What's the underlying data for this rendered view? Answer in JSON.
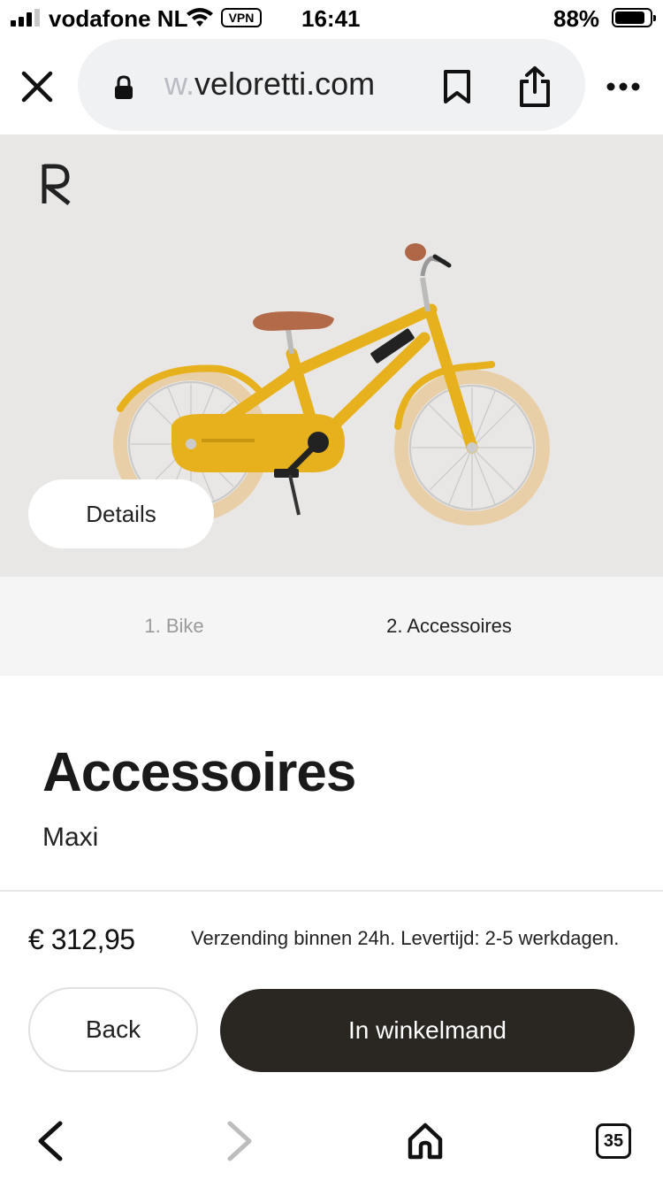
{
  "status_bar": {
    "carrier": "vodafone NL",
    "vpn": "VPN",
    "time": "16:41",
    "battery": "88%",
    "battery_level": 0.88
  },
  "browser": {
    "url_faded": "w.",
    "url_main": "veloretti.com",
    "icons": [
      "close-icon",
      "lock-icon",
      "bookmark-icon",
      "share-icon",
      "more-icon"
    ]
  },
  "hero": {
    "logo": "R",
    "details_label": "Details",
    "bike_color": "#e7b11e"
  },
  "steps": {
    "step1": "1. Bike",
    "step2": "2. Accessoires"
  },
  "content": {
    "title": "Accessoires",
    "subtitle": "Maxi"
  },
  "checkout": {
    "price": "€ 312,95",
    "shipping": "Verzending binnen 24h. Levertijd: 2-5 werkdagen.",
    "back_label": "Back",
    "cart_label": "In winkelmand",
    "cart_color": "#2a2723"
  },
  "toolbar": {
    "tabs_count": "35",
    "icons": [
      "back-arrow-icon",
      "forward-arrow-icon",
      "home-icon",
      "tabs-icon"
    ]
  }
}
